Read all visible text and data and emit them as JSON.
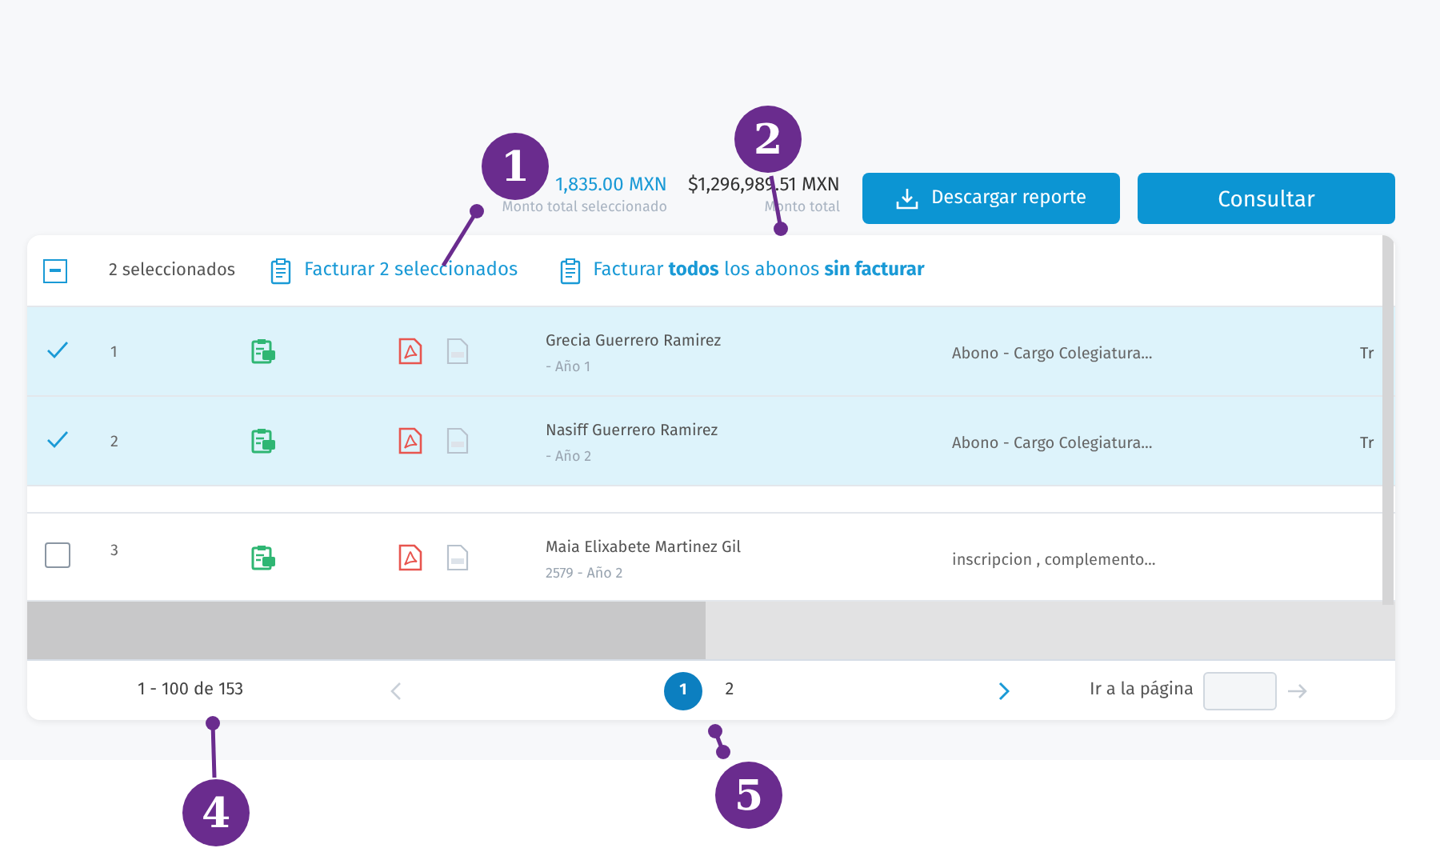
{
  "summary": {
    "selected_amount": "1,835.00 MXN",
    "selected_label": "Monto total seleccionado",
    "total_amount": "$1,296,989.51 MXN",
    "total_label": "Monto total"
  },
  "buttons": [
    {
      "kind": "download",
      "label": "Descargar reporte"
    },
    {
      "kind": "primary",
      "label": "Consultar"
    }
  ],
  "toolbar": {
    "select_all_indeterminate": true,
    "selected_count": "2 seleccionados",
    "invoice_selected": "Facturar 2 seleccionados",
    "invoice_all": "Facturar **todos** los abonos **sin facturar**"
  },
  "rows": [
    {
      "selected": true,
      "number": "1",
      "name": "Grecia Guerrero Ramirez",
      "detail": "- Año 1",
      "concept": "Abono - Cargo Colegiatura...",
      "column_6": "Tr"
    },
    {
      "selected": true,
      "number": "2",
      "name": "Nasiff Guerrero Ramirez",
      "detail": "- Año 2",
      "concept": "Abono - Cargo Colegiatura...",
      "column_6": "Tr"
    },
    {
      "selected": false,
      "number": "3",
      "name": "Maia Elixabete Martinez Gil",
      "detail": "2579 - Año 2",
      "concept": "inscripcion , complemento..."
    }
  ],
  "pagination": {
    "range": "1 - 100 de 153",
    "prev_disabled": true,
    "next_disabled": false,
    "pages": [
      {
        "label": "1",
        "selected": true
      },
      {
        "label": "2",
        "selected": false
      }
    ],
    "goto_label": "Ir a la página"
  },
  "callouts": [
    {
      "label": "1"
    },
    {
      "label": "2"
    },
    {
      "label": "4"
    },
    {
      "label": "5"
    }
  ]
}
